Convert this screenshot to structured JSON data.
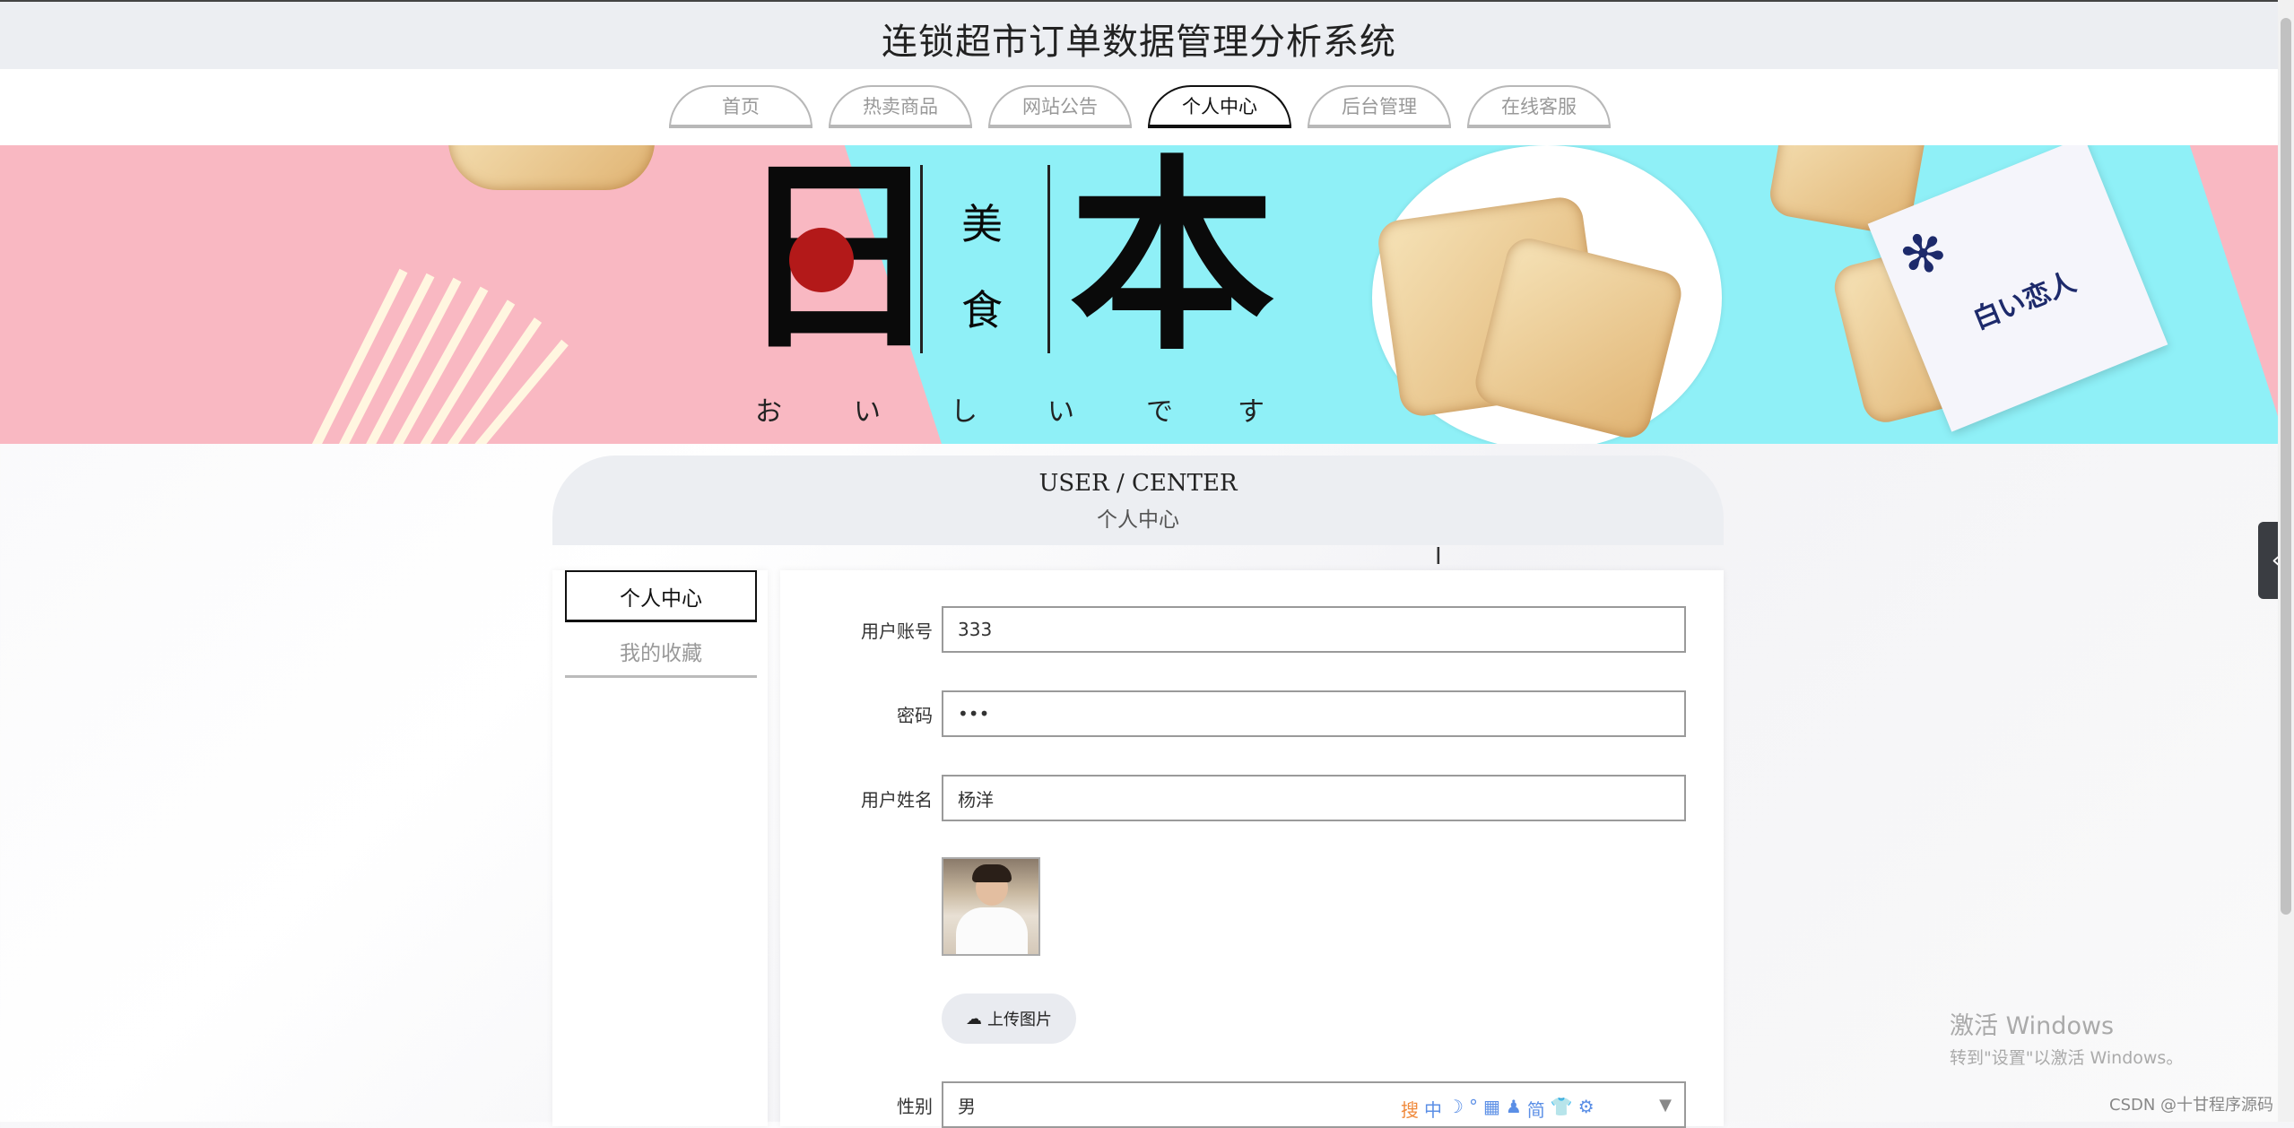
{
  "site": {
    "title": "连锁超市订单数据管理分析系统"
  },
  "nav": {
    "tabs": [
      {
        "label": "首页"
      },
      {
        "label": "热卖商品"
      },
      {
        "label": "网站公告"
      },
      {
        "label": "个人中心",
        "active": true
      },
      {
        "label": "后台管理"
      },
      {
        "label": "在线客服"
      }
    ]
  },
  "banner": {
    "char_1": "日",
    "char_2": "本",
    "char_small_1": "美",
    "char_small_2": "食",
    "kana": [
      "お",
      "い",
      "し",
      "い",
      "で",
      "す"
    ],
    "pack_text": "白い恋人",
    "colors": {
      "left": "#f9b8c2",
      "right": "#8ff0f7",
      "dot": "#b31919"
    }
  },
  "section": {
    "en": "USER / CENTER",
    "cn": "个人中心"
  },
  "side_menu": {
    "items": [
      {
        "label": "个人中心",
        "active": true
      },
      {
        "label": "我的收藏"
      }
    ]
  },
  "form": {
    "account": {
      "label": "用户账号",
      "value": "333"
    },
    "password": {
      "label": "密码",
      "value": "•••"
    },
    "name": {
      "label": "用户姓名",
      "value": "杨洋"
    },
    "upload": {
      "label": "上传图片"
    },
    "gender": {
      "label": "性别",
      "value": "男"
    },
    "ime_icons": [
      "搜",
      "中",
      "☽",
      "°",
      "▦",
      "♟",
      "简",
      "👕",
      "⚙"
    ]
  },
  "os": {
    "activate_title": "激活 Windows",
    "activate_sub": "转到\"设置\"以激活 Windows。",
    "watermark": "CSDN @十甘程序源码"
  }
}
